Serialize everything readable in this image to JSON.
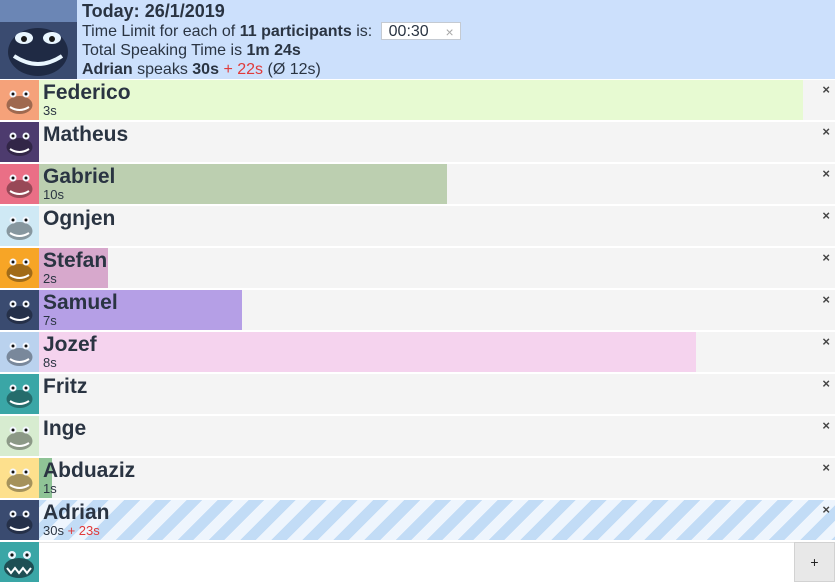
{
  "header": {
    "today_label": "Today:",
    "date": "26/1/2019",
    "limit_prefix": "Time Limit for each of",
    "participant_count": "11",
    "participants_word": "participants",
    "limit_suffix": "is:",
    "limit_value": "00:30",
    "clear_icon": "×",
    "total_prefix": "Total Speaking Time is",
    "total_value": "1m 24s",
    "speaker_name": "Adrian",
    "speaks_word": "speaks",
    "speaker_time": "30s",
    "speaker_over": "+ 22s",
    "speaker_avg": "(Ø 12s)"
  },
  "participants": [
    {
      "name": "Federico",
      "time": "3s",
      "bar_fraction": 0.9594,
      "bar_color": "#e7fad2",
      "avatar_color": "#f5a27a",
      "delete": "×"
    },
    {
      "name": "Matheus",
      "time": "",
      "bar_fraction": 0,
      "bar_color": "#f4f4f4",
      "avatar_color": "#4d3b6e",
      "delete": "×"
    },
    {
      "name": "Gabriel",
      "time": "10s",
      "bar_fraction": 0.5122,
      "bar_color": "#bccfb0",
      "avatar_color": "#ea6f86",
      "delete": "×"
    },
    {
      "name": "Ognjen",
      "time": "",
      "bar_fraction": 0,
      "bar_color": "#f4f4f4",
      "avatar_color": "#cfe9f5",
      "delete": "×"
    },
    {
      "name": "Stefan",
      "time": "2s",
      "bar_fraction": 0.0866,
      "bar_color": "#d7a8cc",
      "avatar_color": "#f7a526",
      "delete": "×"
    },
    {
      "name": "Samuel",
      "time": "7s",
      "bar_fraction": 0.2549,
      "bar_color": "#b59fe6",
      "avatar_color": "#3a4b70",
      "delete": "×"
    },
    {
      "name": "Jozef",
      "time": "8s",
      "bar_fraction": 0.8256,
      "bar_color": "#f5d3ee",
      "avatar_color": "#bad2ee",
      "delete": "×"
    },
    {
      "name": "Fritz",
      "time": "",
      "bar_fraction": 0,
      "bar_color": "#f4f4f4",
      "avatar_color": "#3aa6a6",
      "delete": "×"
    },
    {
      "name": "Inge",
      "time": "",
      "bar_fraction": 0,
      "bar_color": "#f4f4f4",
      "avatar_color": "#d7ecd0",
      "delete": "×"
    },
    {
      "name": "Abduaziz",
      "time": "1s",
      "bar_fraction": 0.0166,
      "bar_color": "#8fc396",
      "avatar_color": "#fde08d",
      "delete": "×"
    },
    {
      "name": "Adrian",
      "time": "30s",
      "time_over": "+ 23s",
      "bar_fraction": 1,
      "bar_color": "striped",
      "avatar_color": "#3a4b70",
      "delete": "×",
      "speaking": true
    }
  ],
  "add_row": {
    "input_value": "",
    "input_placeholder": "",
    "add_label": "+"
  }
}
